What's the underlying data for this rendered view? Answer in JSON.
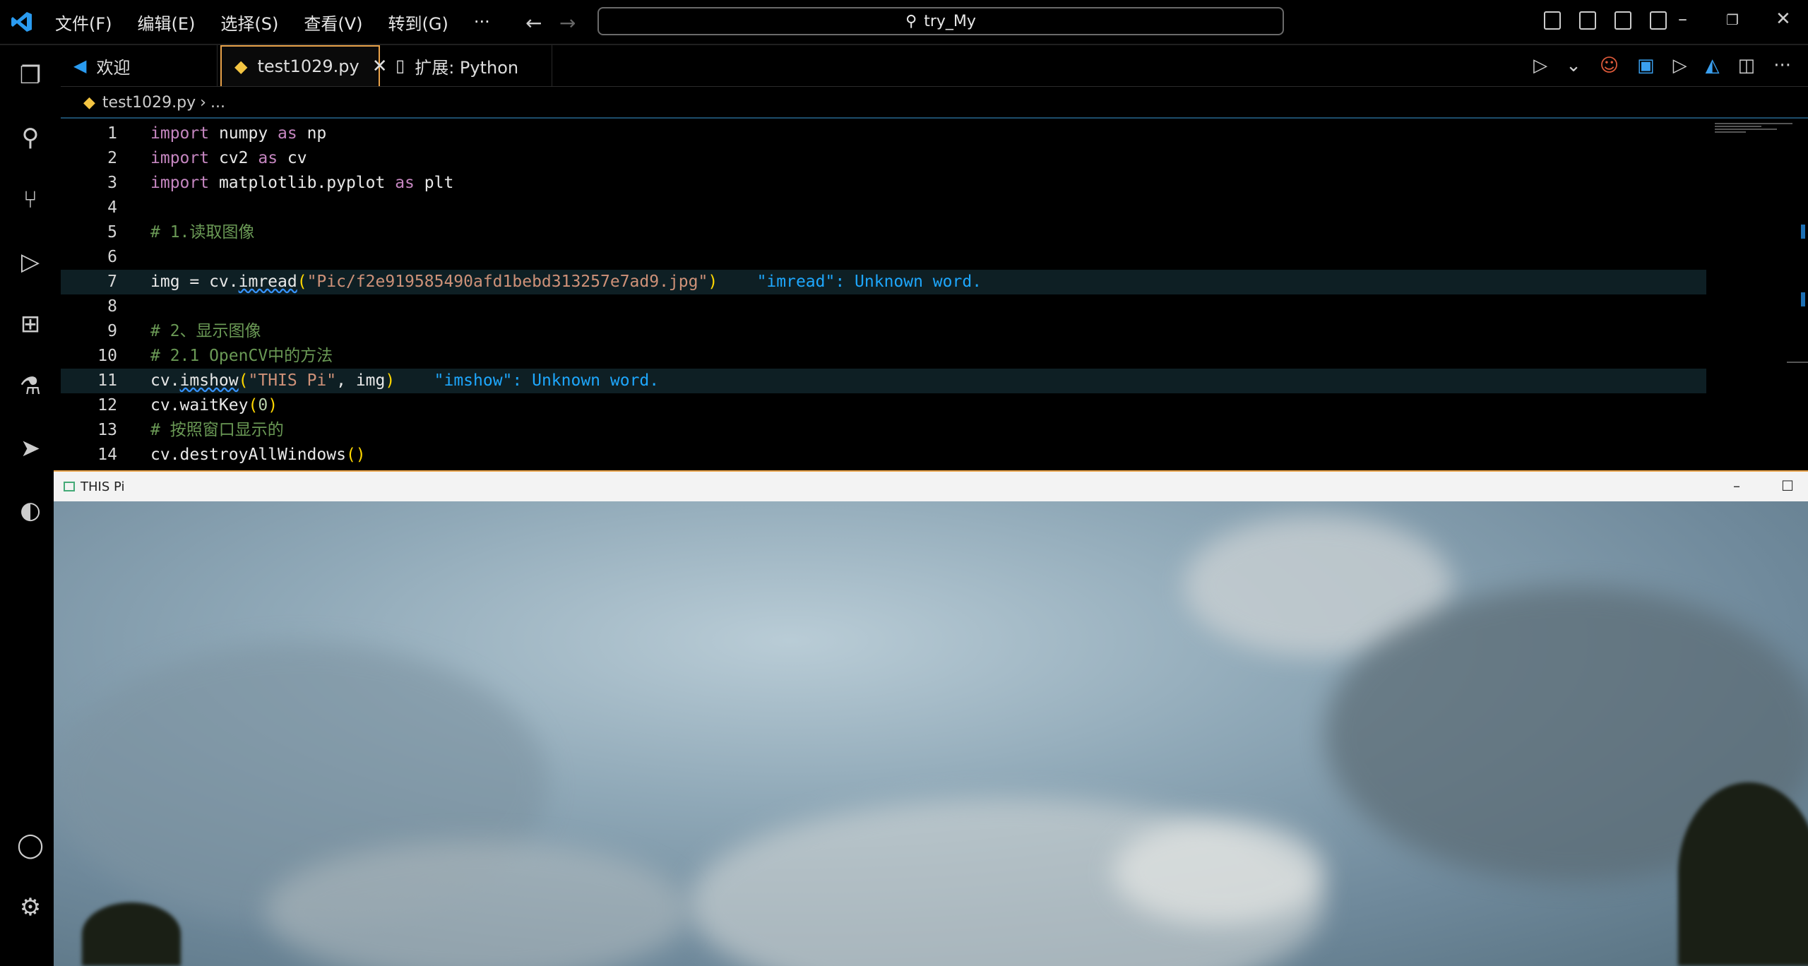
{
  "titlebar": {
    "menu": [
      "文件(F)",
      "编辑(E)",
      "选择(S)",
      "查看(V)",
      "转到(G)"
    ],
    "more": "···",
    "search_text": "try_My"
  },
  "tabs": [
    {
      "label": "欢迎",
      "icon": "vscode-icon"
    },
    {
      "label": "test1029.py",
      "icon": "python-icon",
      "active": true
    },
    {
      "label": "扩展: Python",
      "icon": "file-icon"
    }
  ],
  "breadcrumb": {
    "file": "test1029.py",
    "rest": "..."
  },
  "editor": {
    "lines": [
      {
        "n": "1"
      },
      {
        "n": "2"
      },
      {
        "n": "3"
      },
      {
        "n": "4"
      },
      {
        "n": "5"
      },
      {
        "n": "6"
      },
      {
        "n": "7"
      },
      {
        "n": "8"
      },
      {
        "n": "9"
      },
      {
        "n": "10"
      },
      {
        "n": "11"
      },
      {
        "n": "12"
      },
      {
        "n": "13"
      },
      {
        "n": "14"
      }
    ],
    "code": {
      "l1a": "import",
      "l1b": " numpy ",
      "l1c": "as",
      "l1d": " np",
      "l2a": "import",
      "l2b": " cv2 ",
      "l2c": "as",
      "l2d": " cv",
      "l3a": "import",
      "l3b": " matplotlib.pyplot ",
      "l3c": "as",
      "l3d": " plt",
      "l5": "# 1.读取图像",
      "l7a": "img = cv.",
      "l7b": "imread",
      "l7c": "(",
      "l7d": "\"Pic/f2e919585490afd1bebd313257e7ad9.jpg\"",
      "l7e": ")",
      "l7err": "\"imread\": Unknown word.",
      "l9": "# 2、显示图像",
      "l10": "# 2.1 OpenCV中的方法",
      "l11a": "cv.",
      "l11b": "imshow",
      "l11c": "(",
      "l11d": "\"THIS Pi\"",
      "l11e": ", img",
      "l11f": ")",
      "l11err": "\"imshow\": Unknown word.",
      "l12a": "cv.waitKey",
      "l12b": "(",
      "l12c": "0",
      "l12d": ")",
      "l13": "# 按照窗口显示的",
      "l14a": "cv.destroyAllWindows",
      "l14b": "()"
    }
  },
  "image_window": {
    "title": "THIS Pi"
  }
}
